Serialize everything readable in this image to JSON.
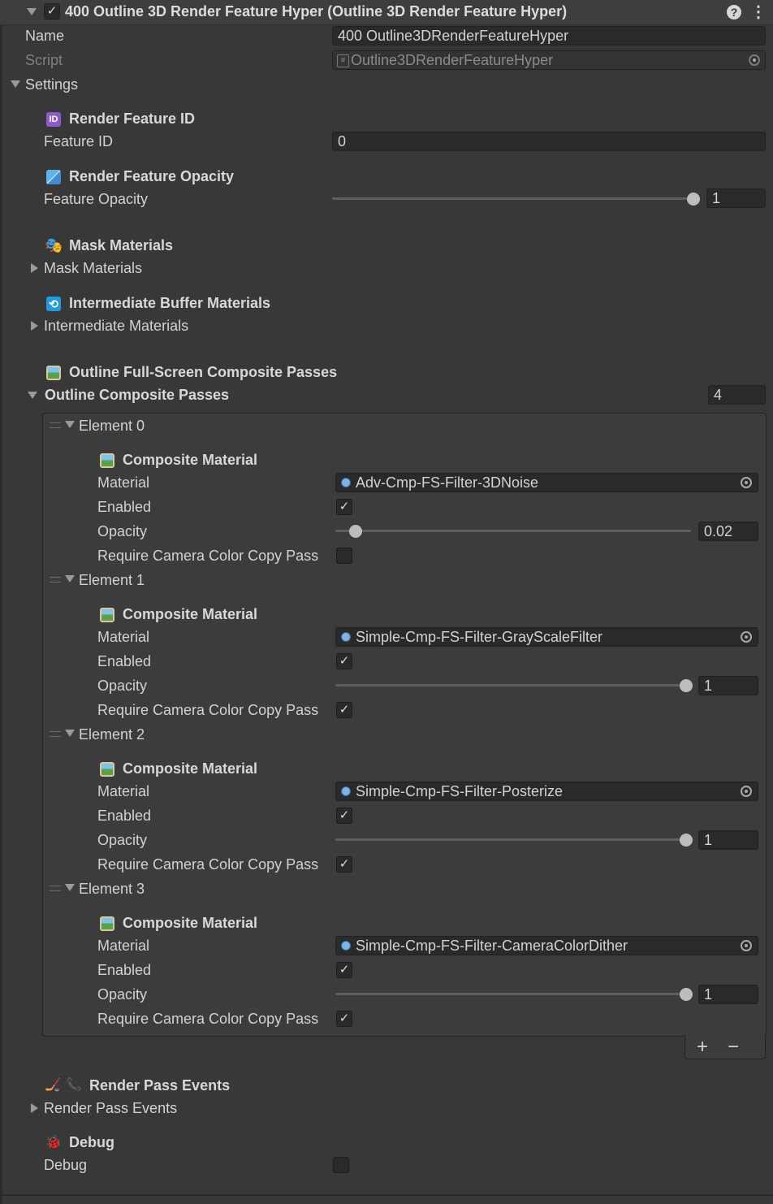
{
  "header": {
    "title": "400 Outline 3D Render Feature Hyper (Outline 3D Render Feature Hyper)",
    "help_icon": "help-icon",
    "menu_icon": "kebab-menu-icon"
  },
  "name": {
    "label": "Name",
    "value": "400 Outline3DRenderFeatureHyper"
  },
  "script": {
    "label": "Script",
    "value": "Outline3DRenderFeatureHyper"
  },
  "settings_label": "Settings",
  "render_feature_id": {
    "title": "Render Feature ID",
    "label": "Feature ID",
    "value": "0"
  },
  "render_feature_opacity": {
    "title": "Render Feature Opacity",
    "label": "Feature Opacity",
    "value": "1",
    "fraction": 1.0
  },
  "mask_materials": {
    "title": "Mask Materials",
    "label": "Mask Materials"
  },
  "intermediate": {
    "title": "Intermediate Buffer Materials",
    "label": "Intermediate Materials"
  },
  "outline_composite": {
    "title": "Outline Full-Screen Composite Passes",
    "label": "Outline Composite Passes",
    "count": "4",
    "elements": [
      {
        "label": "Element 0",
        "section": "Composite Material",
        "material_label": "Material",
        "material": "Adv-Cmp-FS-Filter-3DNoise",
        "enabled_label": "Enabled",
        "enabled": true,
        "opacity_label": "Opacity",
        "opacity": "0.02",
        "opacity_fraction": 0.02,
        "require_label": "Require Camera Color Copy Pass",
        "require": false
      },
      {
        "label": "Element 1",
        "section": "Composite Material",
        "material_label": "Material",
        "material": "Simple-Cmp-FS-Filter-GrayScaleFilter",
        "enabled_label": "Enabled",
        "enabled": true,
        "opacity_label": "Opacity",
        "opacity": "1",
        "opacity_fraction": 1.0,
        "require_label": "Require Camera Color Copy Pass",
        "require": true
      },
      {
        "label": "Element 2",
        "section": "Composite Material",
        "material_label": "Material",
        "material": "Simple-Cmp-FS-Filter-Posterize",
        "enabled_label": "Enabled",
        "enabled": true,
        "opacity_label": "Opacity",
        "opacity": "1",
        "opacity_fraction": 1.0,
        "require_label": "Require Camera Color Copy Pass",
        "require": true
      },
      {
        "label": "Element 3",
        "section": "Composite Material",
        "material_label": "Material",
        "material": "Simple-Cmp-FS-Filter-CameraColorDither",
        "enabled_label": "Enabled",
        "enabled": true,
        "opacity_label": "Opacity",
        "opacity": "1",
        "opacity_fraction": 1.0,
        "require_label": "Require Camera Color Copy Pass",
        "require": true
      }
    ],
    "add": "+",
    "remove": "−"
  },
  "render_pass_events": {
    "title": "Render Pass Events",
    "label": "Render Pass Events"
  },
  "debug": {
    "title": "Debug",
    "label": "Debug",
    "value": false
  },
  "colors": {
    "background": "#383838",
    "field": "#2a2a2a",
    "accent_blue": "#7ab4e8"
  }
}
